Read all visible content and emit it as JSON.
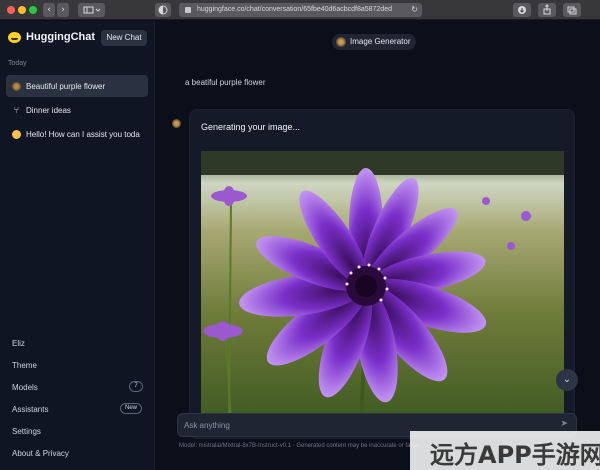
{
  "browser": {
    "url": "huggingface.co/chat/conversation/65fbe40d6acbcdf8a5872ded",
    "back_icon": "‹",
    "forward_icon": "›",
    "reload_icon": "↻"
  },
  "sidebar": {
    "brand": "HuggingChat",
    "new_chat": "New Chat",
    "section": "Today",
    "conversations": [
      {
        "label": "Beautiful purple flower",
        "icon": "flower-icon"
      },
      {
        "label": "Dinner ideas",
        "icon": "fork-knife-icon"
      },
      {
        "label": "Hello! How can I assist you toda",
        "icon": "smile-icon"
      }
    ],
    "bottom": {
      "user": "Eliz",
      "theme": "Theme",
      "models": "Models",
      "models_count": "7",
      "assistants": "Assistants",
      "assistants_badge": "New",
      "settings": "Settings",
      "about": "About & Privacy"
    }
  },
  "main": {
    "model_chip": "Image Generator",
    "user_message": "a beatiful purple flower",
    "assistant_message": "Generating your image...",
    "input_placeholder": "Ask anything",
    "footer_note": "Model: mistralai/Mixtral-8x7B-Instruct-v0.1 · Generated content may be inaccurate or false."
  },
  "watermark": "远方APP手游网",
  "colors": {
    "background": "#0b0f19",
    "sidebar": "#0f1523",
    "accent_flower": "#7c3aed"
  }
}
